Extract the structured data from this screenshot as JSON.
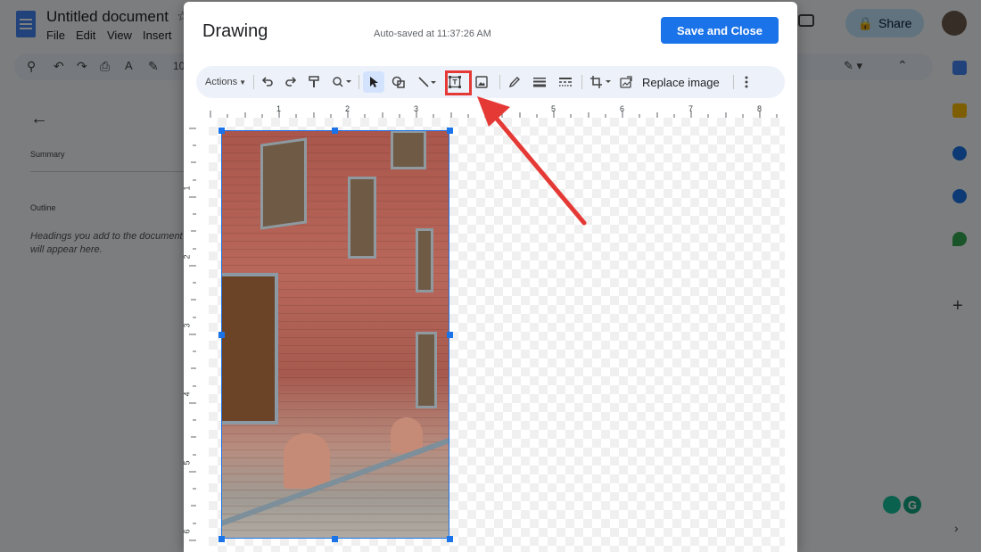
{
  "docs": {
    "title": "Untitled document",
    "menu": [
      "File",
      "Edit",
      "View",
      "Insert"
    ],
    "zoom_partial": "10",
    "share_label": "Share",
    "outline": {
      "summary_label": "Summary",
      "outline_label": "Outline",
      "hint": "Headings you add to the document will appear here."
    }
  },
  "dialog": {
    "title": "Drawing",
    "autosave": "Auto-saved at 11:37:26 AM",
    "save_close_label": "Save and Close",
    "toolbar": {
      "actions_label": "Actions",
      "replace_image_label": "Replace image",
      "icons": [
        "undo-icon",
        "redo-icon",
        "paint-format-icon",
        "zoom-icon",
        "select-icon",
        "shape-icon",
        "line-icon",
        "text-box-icon",
        "image-icon",
        "pen-icon",
        "line-weight-icon",
        "line-dash-icon",
        "crop-icon",
        "reset-image-icon",
        "more-icon"
      ],
      "highlighted_tool": "text-box-icon"
    },
    "ruler": {
      "horizontal_labels": [
        "1",
        "2",
        "3",
        "4",
        "5",
        "6",
        "7",
        "8"
      ],
      "vertical_labels": [
        "1",
        "2",
        "3",
        "4",
        "5",
        "6"
      ]
    }
  },
  "colors": {
    "accent": "#1a73e8",
    "highlight": "#e53935",
    "share_bg": "#c2e7ff"
  }
}
